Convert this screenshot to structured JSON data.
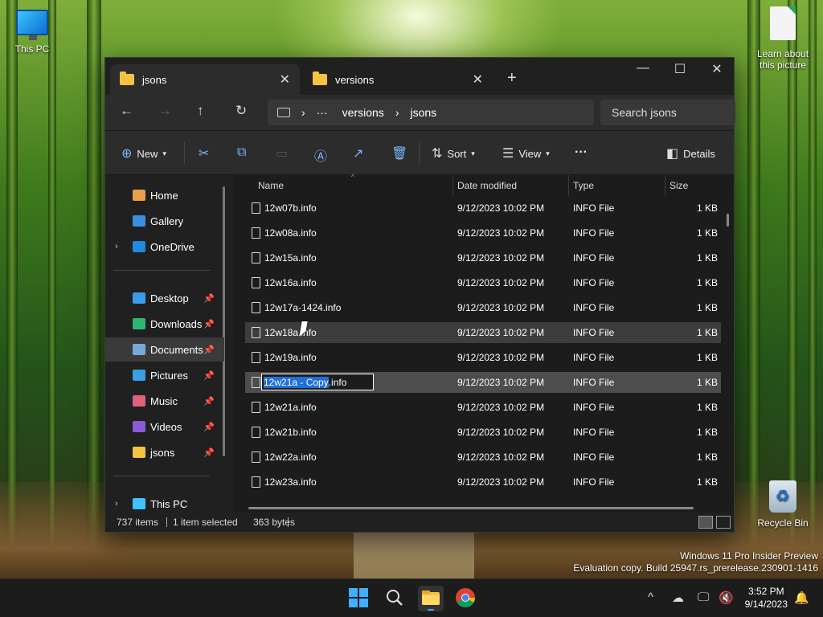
{
  "desktop": {
    "icons": [
      {
        "label": "This PC"
      },
      {
        "label": "Learn about this picture"
      },
      {
        "label": "Recycle Bin"
      }
    ],
    "watermark": {
      "line1": "Windows 11 Pro Insider Preview",
      "line2": "Evaluation copy. Build 25947.rs_prerelease.230901-1416"
    }
  },
  "window": {
    "tabs": [
      {
        "label": "jsons",
        "active": true
      },
      {
        "label": "versions",
        "active": false
      }
    ],
    "controls": {
      "minimize": "—",
      "maximize": "☐",
      "close": "✕",
      "new_tab": "+"
    },
    "address": {
      "more": "···",
      "crumbs": [
        "versions",
        "jsons"
      ],
      "separator": "›"
    },
    "search": {
      "placeholder": "Search jsons"
    },
    "toolbar": {
      "new_label": "New",
      "sort_label": "Sort",
      "view_label": "View",
      "more": "···",
      "details_label": "Details"
    },
    "nav": {
      "items": [
        {
          "label": "Home",
          "icon": "home-icon",
          "color": "#e8a04a"
        },
        {
          "label": "Gallery",
          "icon": "gallery-icon",
          "color": "#3b8fe0"
        },
        {
          "label": "OneDrive",
          "icon": "cloud-icon",
          "color": "#1f8ae0"
        },
        {
          "label": "Desktop",
          "icon": "desktop-icon",
          "color": "#3b9be8",
          "pinned": true
        },
        {
          "label": "Downloads",
          "icon": "download-icon",
          "color": "#2bb673",
          "pinned": true
        },
        {
          "label": "Documents",
          "icon": "document-icon",
          "color": "#7aa8d8",
          "pinned": true,
          "selected": true
        },
        {
          "label": "Pictures",
          "icon": "pictures-icon",
          "color": "#3a9ee0",
          "pinned": true
        },
        {
          "label": "Music",
          "icon": "music-icon",
          "color": "#e0607a",
          "pinned": true
        },
        {
          "label": "Videos",
          "icon": "videos-icon",
          "color": "#8a5ad8",
          "pinned": true
        },
        {
          "label": "jsons",
          "icon": "folder-icon",
          "color": "#f5c242",
          "pinned": true
        },
        {
          "label": "This PC",
          "icon": "pc-icon",
          "color": "#3fc3ff"
        }
      ]
    },
    "columns": {
      "name": "Name",
      "date": "Date modified",
      "type": "Type",
      "size": "Size"
    },
    "files": [
      {
        "name": "12w07b.info",
        "date": "9/12/2023 10:02 PM",
        "type": "INFO File",
        "size": "1 KB"
      },
      {
        "name": "12w08a.info",
        "date": "9/12/2023 10:02 PM",
        "type": "INFO File",
        "size": "1 KB"
      },
      {
        "name": "12w15a.info",
        "date": "9/12/2023 10:02 PM",
        "type": "INFO File",
        "size": "1 KB"
      },
      {
        "name": "12w16a.info",
        "date": "9/12/2023 10:02 PM",
        "type": "INFO File",
        "size": "1 KB"
      },
      {
        "name": "12w17a-1424.info",
        "date": "9/12/2023 10:02 PM",
        "type": "INFO File",
        "size": "1 KB"
      },
      {
        "name": "12w18a.info",
        "date": "9/12/2023 10:02 PM",
        "type": "INFO File",
        "size": "1 KB"
      },
      {
        "name": "12w19a.info",
        "date": "9/12/2023 10:02 PM",
        "type": "INFO File",
        "size": "1 KB"
      },
      {
        "name": "12w21a - Copy.info",
        "date": "9/12/2023 10:02 PM",
        "type": "INFO File",
        "size": "1 KB"
      },
      {
        "name": "12w21a.info",
        "date": "9/12/2023 10:02 PM",
        "type": "INFO File",
        "size": "1 KB"
      },
      {
        "name": "12w21b.info",
        "date": "9/12/2023 10:02 PM",
        "type": "INFO File",
        "size": "1 KB"
      },
      {
        "name": "12w22a.info",
        "date": "9/12/2023 10:02 PM",
        "type": "INFO File",
        "size": "1 KB"
      },
      {
        "name": "12w23a.info",
        "date": "9/12/2023 10:02 PM",
        "type": "INFO File",
        "size": "1 KB"
      }
    ],
    "rename": {
      "selected_part": "12w21a - Copy",
      "rest": ".info"
    },
    "status": {
      "items": "737 items",
      "selection": "1 item selected",
      "bytes": "363 bytes"
    }
  },
  "taskbar": {
    "clock": {
      "time": "3:52 PM",
      "date": "9/14/2023"
    },
    "tray_chevron": "^"
  }
}
